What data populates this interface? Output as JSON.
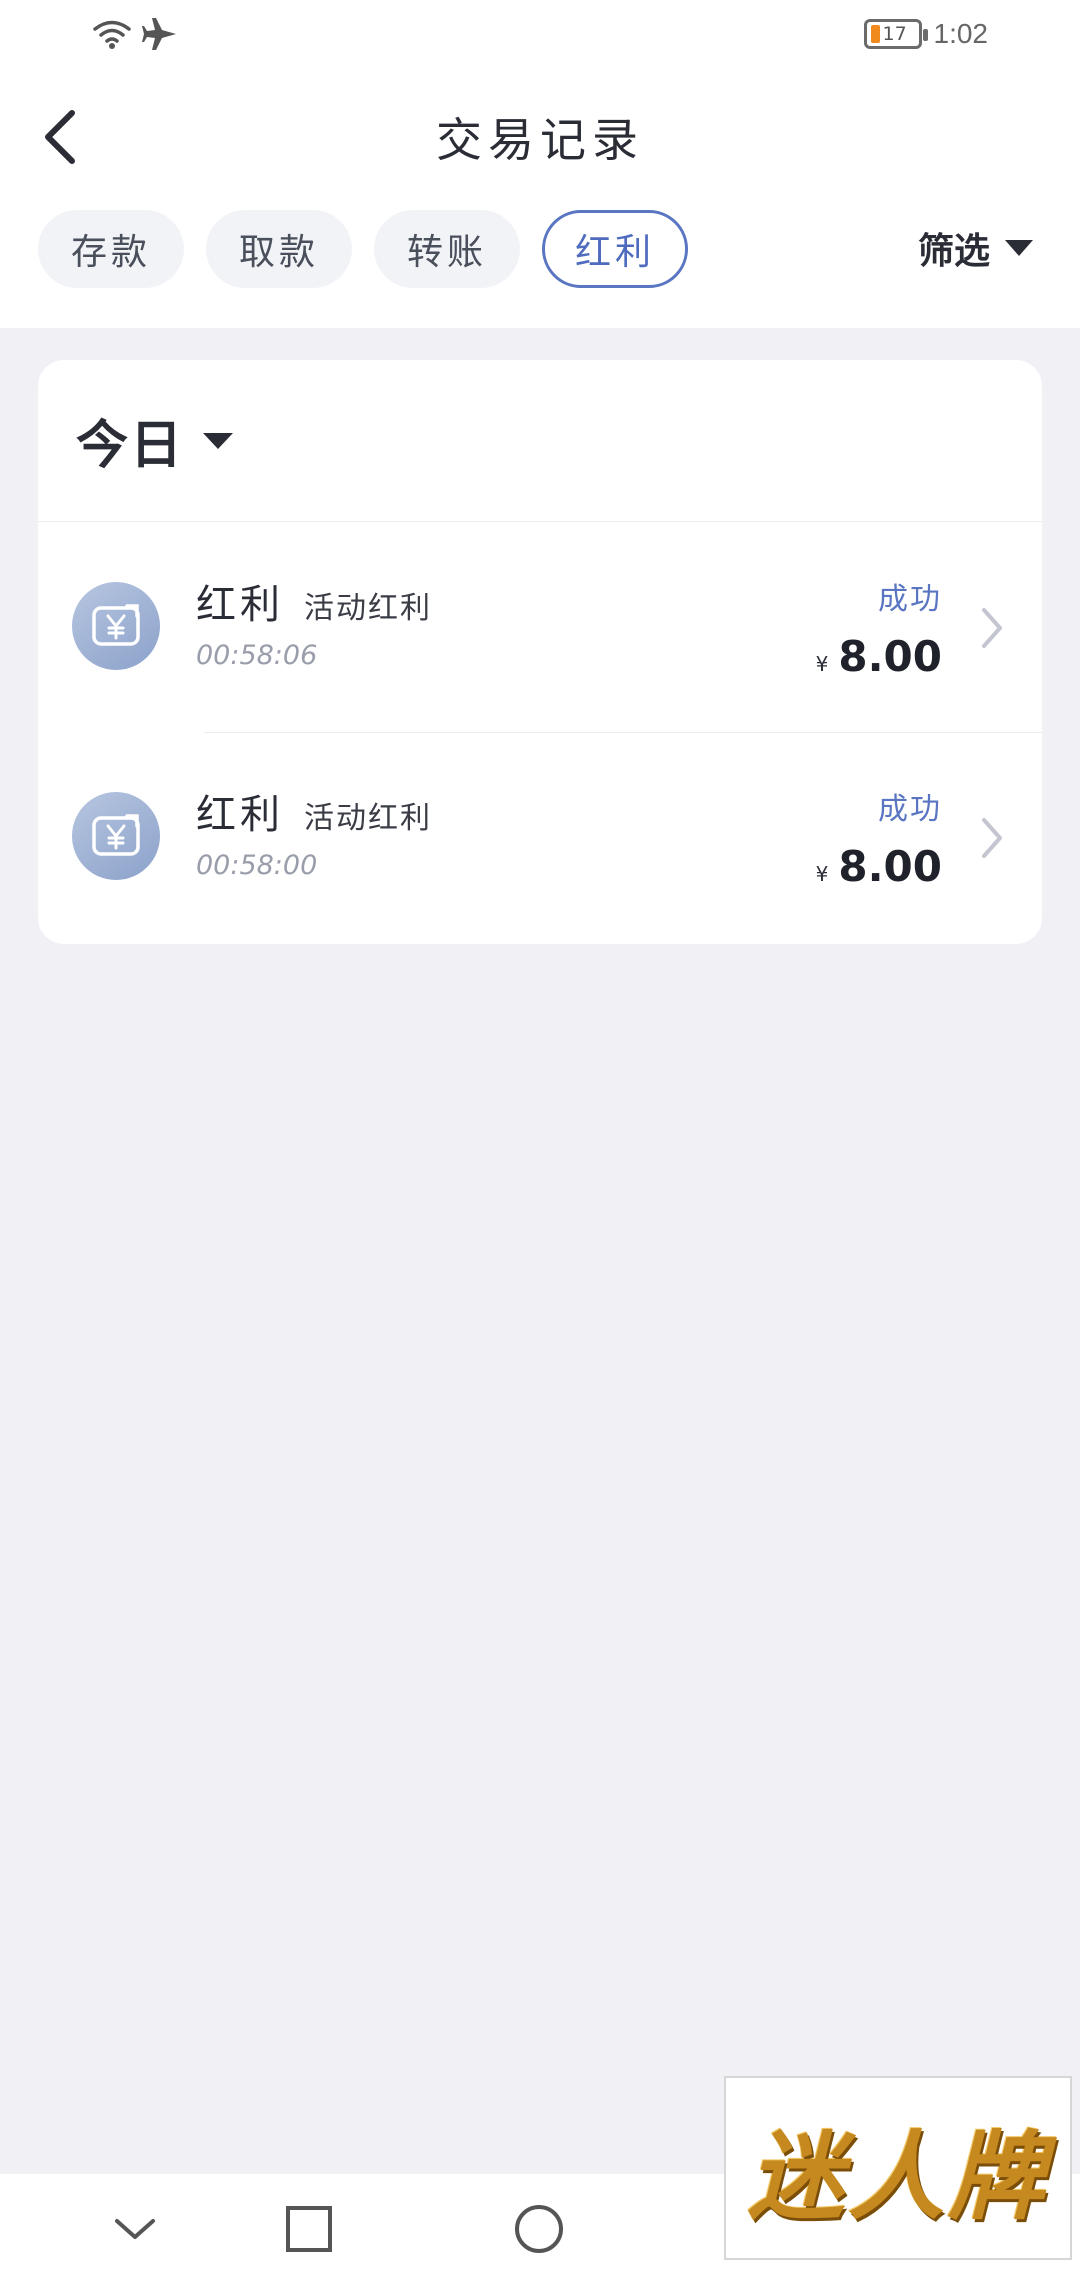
{
  "status_bar": {
    "battery_level": "17",
    "time": "1:02",
    "icons": [
      "wifi-icon",
      "airplane-icon"
    ]
  },
  "header": {
    "title": "交易记录",
    "back_icon": "back-chevron-icon"
  },
  "tabs": [
    {
      "label": "存款",
      "active": false
    },
    {
      "label": "取款",
      "active": false
    },
    {
      "label": "转账",
      "active": false
    },
    {
      "label": "红利",
      "active": true
    }
  ],
  "filter": {
    "label": "筛选",
    "icon": "caret-down-icon"
  },
  "records": {
    "period": "今日",
    "items": [
      {
        "type": "红利",
        "subtype": "活动红利",
        "time": "00:58:06",
        "status": "成功",
        "currency": "¥",
        "amount": "8.00",
        "icon": "bonus-yuan-icon"
      },
      {
        "type": "红利",
        "subtype": "活动红利",
        "time": "00:58:00",
        "status": "成功",
        "currency": "¥",
        "amount": "8.00",
        "icon": "bonus-yuan-icon"
      }
    ]
  },
  "nav_bar": {
    "buttons": [
      "nav-back-icon",
      "nav-recents-icon",
      "nav-home-icon"
    ]
  },
  "watermark": {
    "text": "迷人牌"
  },
  "colors": {
    "accent": "#5a76c2",
    "background": "#f0f0f5",
    "battery_low": "#f08a1c"
  }
}
